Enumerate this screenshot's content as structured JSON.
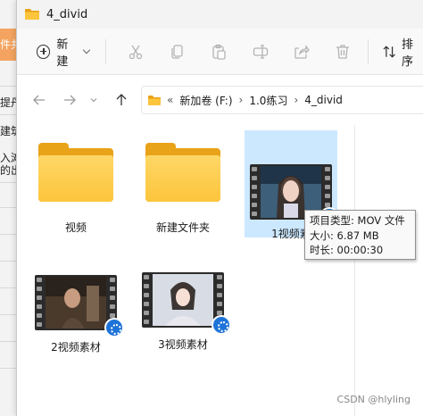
{
  "background_window": {
    "tab_text": "件共",
    "lines": [
      "提丹",
      "建筑",
      "入滩",
      "的出"
    ]
  },
  "window": {
    "title": "4_divid",
    "title_icon": "folder-icon"
  },
  "commandbar": {
    "new_label": "新建",
    "sort_label": "排序",
    "tools": [
      "cut-icon",
      "copy-icon",
      "paste-icon",
      "rename-icon",
      "share-icon",
      "delete-icon"
    ]
  },
  "address": {
    "overflow": "«",
    "crumbs": [
      "新加卷 (F:)",
      "1.0练习",
      "4_divid"
    ]
  },
  "files": [
    {
      "name": "视频",
      "type": "folder"
    },
    {
      "name": "新建文件夹",
      "type": "folder"
    },
    {
      "name": "1视频素",
      "type": "video",
      "selected": true
    },
    {
      "name": "2视频素材",
      "type": "video"
    },
    {
      "name": "3视频素材",
      "type": "video"
    }
  ],
  "tooltip": {
    "line1": "项目类型: MOV 文件",
    "line2": "大小: 6.87 MB",
    "line3": "时长: 00:00:30"
  },
  "watermark": "CSDN @hlyling",
  "colors": {
    "accent": "#1e73d8",
    "selection": "#cce8ff",
    "folder": "#fcc53c"
  }
}
